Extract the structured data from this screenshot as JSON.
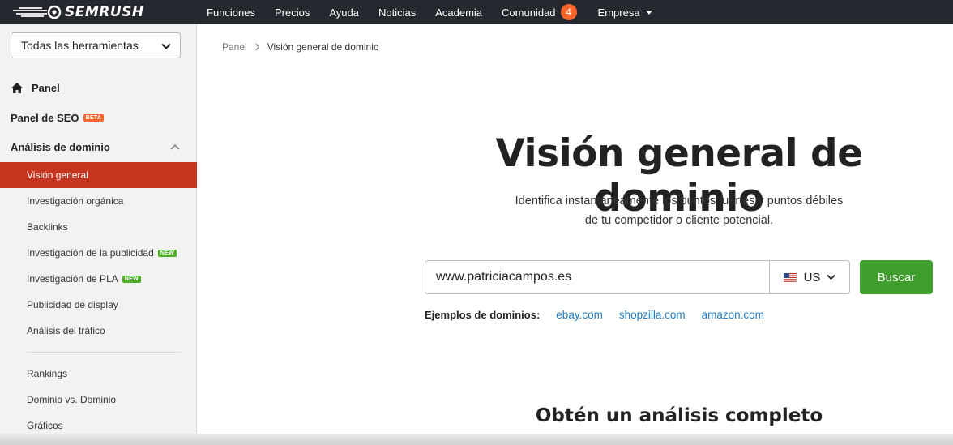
{
  "brand": {
    "name": "SEMRUSH"
  },
  "topnav": {
    "items": [
      {
        "label": "Funciones"
      },
      {
        "label": "Precios"
      },
      {
        "label": "Ayuda"
      },
      {
        "label": "Noticias"
      },
      {
        "label": "Academia"
      },
      {
        "label": "Comunidad",
        "badge": "4"
      },
      {
        "label": "Empresa"
      }
    ]
  },
  "sidebar": {
    "tools_select": "Todas las herramientas",
    "panel": "Panel",
    "seo_panel": "Panel de SEO",
    "seo_badge": "BETA",
    "domain_section": "Análisis de dominio",
    "items": [
      {
        "label": "Visión general"
      },
      {
        "label": "Investigación orgánica"
      },
      {
        "label": "Backlinks"
      },
      {
        "label": "Investigación de la publicidad",
        "badge": "NEW"
      },
      {
        "label": "Investigación de PLA",
        "badge": "NEW"
      },
      {
        "label": "Publicidad de display"
      },
      {
        "label": "Análisis del tráfico"
      },
      {
        "label": "Rankings"
      },
      {
        "label": "Dominio vs. Dominio"
      },
      {
        "label": "Gráficos"
      }
    ]
  },
  "breadcrumb": {
    "root": "Panel",
    "current": "Visión general de dominio"
  },
  "main": {
    "title": "Visión general de dominio",
    "subtitle_line1": "Identifica instantáneamente los puntos fuertes y puntos débiles",
    "subtitle_line2": "de tu competidor o cliente potencial.",
    "search_value": "www.patriciacampos.es",
    "country": "US",
    "search_button": "Buscar",
    "examples_label": "Ejemplos de dominios:",
    "examples": [
      "ebay.com",
      "shopzilla.com",
      "amazon.com"
    ],
    "section_heading": "Obtén un análisis completo"
  },
  "colors": {
    "topbar": "#25292f",
    "accent_red": "#c6351f",
    "orange": "#ff642d",
    "green": "#3f9f2c",
    "link": "#1e7bc4"
  }
}
